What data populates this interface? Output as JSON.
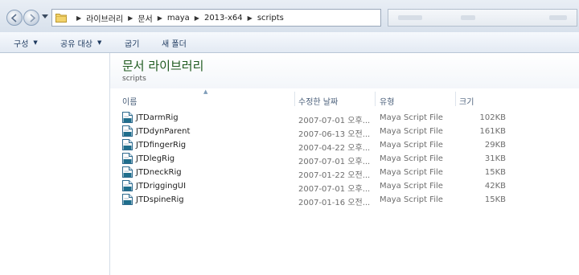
{
  "address": {
    "crumbs": [
      "라이브러리",
      "문서",
      "maya",
      "2013-x64",
      "scripts"
    ]
  },
  "toolbar": {
    "organize": "구성",
    "share": "공유 대상",
    "burn": "굽기",
    "new_folder": "새 폴더"
  },
  "library": {
    "title": "문서 라이브러리",
    "subtitle": "scripts"
  },
  "columns": {
    "name": "이름",
    "date": "수정한 날짜",
    "type": "유형",
    "size": "크기"
  },
  "files": [
    {
      "name": "JTDarmRig",
      "date": "2007-07-01 오후...",
      "type": "Maya Script File",
      "size": "102KB"
    },
    {
      "name": "JTDdynParent",
      "date": "2007-06-13 오전...",
      "type": "Maya Script File",
      "size": "161KB"
    },
    {
      "name": "JTDfingerRig",
      "date": "2007-04-22 오후...",
      "type": "Maya Script File",
      "size": "29KB"
    },
    {
      "name": "JTDlegRig",
      "date": "2007-07-01 오후...",
      "type": "Maya Script File",
      "size": "31KB"
    },
    {
      "name": "JTDneckRig",
      "date": "2007-01-22 오전...",
      "type": "Maya Script File",
      "size": "15KB"
    },
    {
      "name": "JTDriggingUI",
      "date": "2007-07-01 오후...",
      "type": "Maya Script File",
      "size": "42KB"
    },
    {
      "name": "JTDspineRig",
      "date": "2007-01-16 오전...",
      "type": "Maya Script File",
      "size": "15KB"
    }
  ],
  "icons": {
    "back": "back-arrow-icon",
    "forward": "forward-arrow-icon",
    "folder": "folder-icon",
    "file": "maya-script-file-icon",
    "breadcrumb_separator": "chevron-right-icon"
  },
  "colors": {
    "library_title": "#1e5a1e",
    "toolbar_text": "#1e3a5f",
    "column_header_text": "#4a5f7a"
  }
}
